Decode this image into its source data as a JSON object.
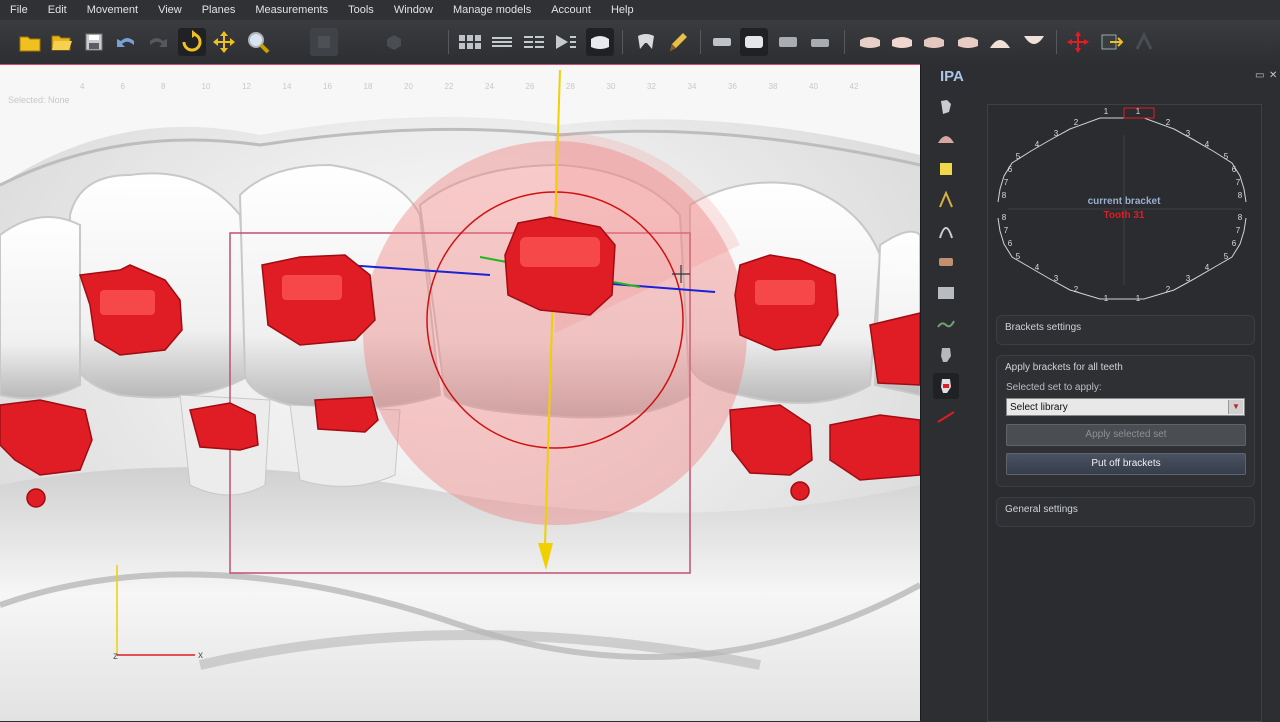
{
  "menu": [
    "File",
    "Edit",
    "Movement",
    "View",
    "Planes",
    "Measurements",
    "Tools",
    "Window",
    "Manage models",
    "Account",
    "Help"
  ],
  "viewport": {
    "status": "Selected: None",
    "ruler_ticks": [
      "4",
      "6",
      "8",
      "10",
      "12",
      "14",
      "16",
      "18",
      "20",
      "22",
      "24",
      "26",
      "28",
      "30",
      "32",
      "34",
      "36",
      "38",
      "40",
      "42"
    ],
    "axis_z": "z",
    "axis_x": "x"
  },
  "panel": {
    "title": "IPA",
    "restore_icon": "restore-icon",
    "close_icon": "close-icon",
    "chart": {
      "current_label": "current bracket",
      "current_tooth": "Tooth 31",
      "upper_left": [
        "1",
        "2",
        "3",
        "4",
        "5",
        "6",
        "7",
        "8"
      ],
      "upper_right": [
        "1",
        "2",
        "3",
        "4",
        "5",
        "6",
        "7",
        "8"
      ],
      "lower_left": [
        "8",
        "7",
        "6",
        "5",
        "4",
        "3",
        "2",
        "1"
      ],
      "lower_right": [
        "8",
        "7",
        "6",
        "5",
        "4",
        "3",
        "2",
        "1"
      ]
    },
    "brackets_settings": "Brackets settings",
    "apply_all": "Apply brackets for all teeth",
    "selected_set_label": "Selected set to apply:",
    "select_value": "Select library",
    "apply_button": "Apply selected set",
    "putoff_button": "Put off brackets",
    "general_settings": "General settings"
  },
  "colors": {
    "accent": "#e01c24",
    "panel_title": "#a9c6e8",
    "yellow_axis": "#f0d000",
    "blue_axis": "#1a22d8"
  }
}
